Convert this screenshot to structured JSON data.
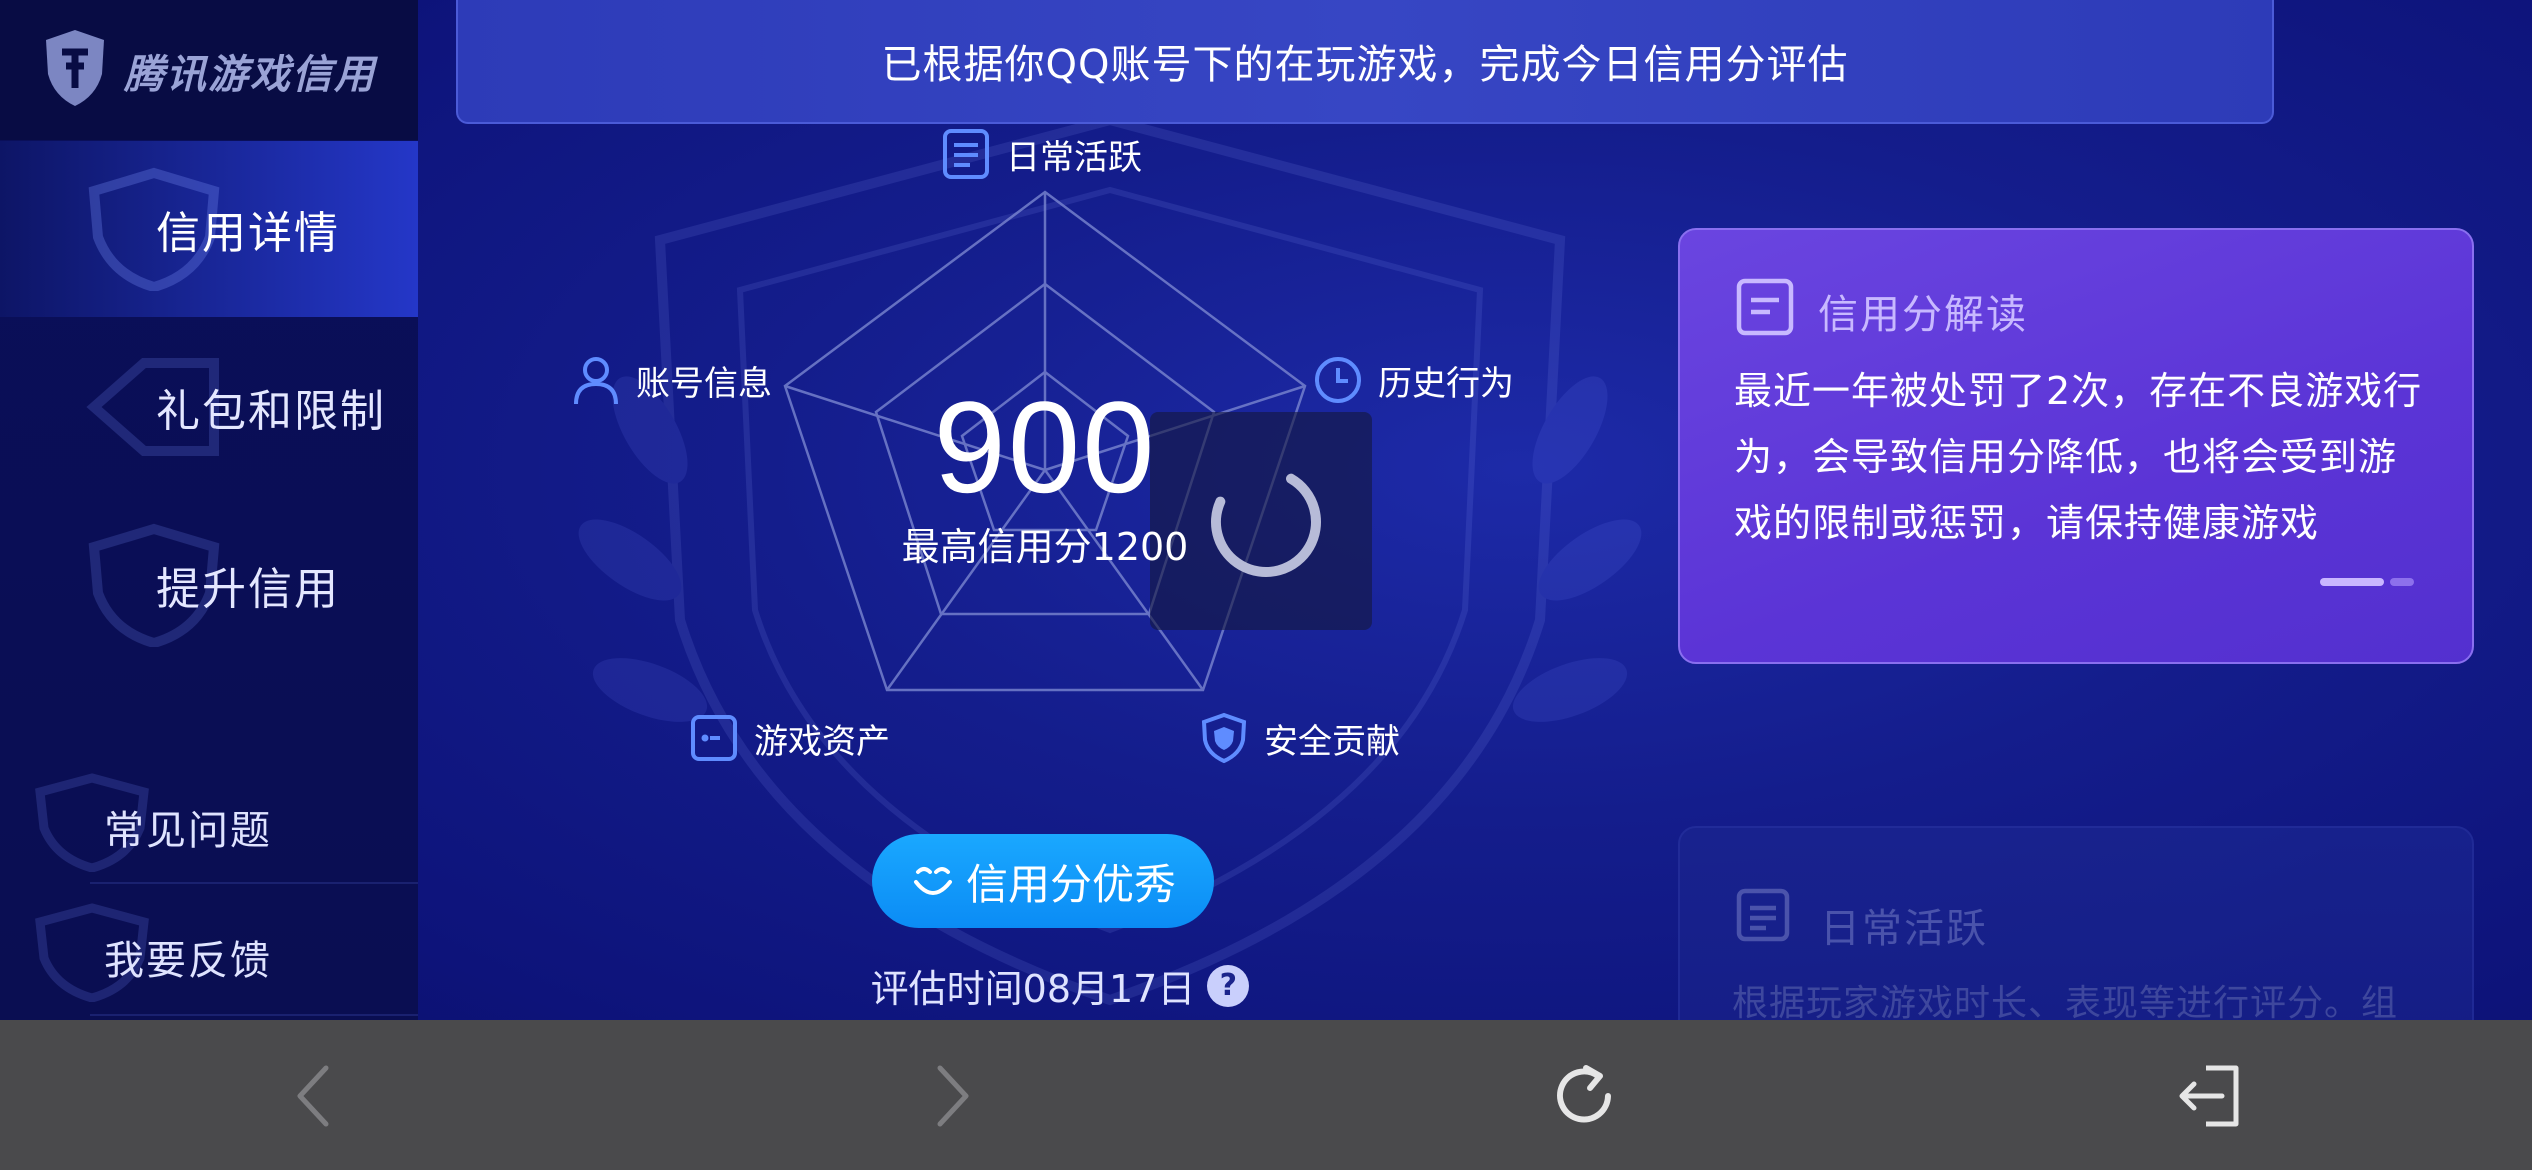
{
  "app": {
    "logo_text": "腾讯游戏信用"
  },
  "sidebar": {
    "items": [
      {
        "label": "信用详情",
        "active": true
      },
      {
        "label": "礼包和限制",
        "active": false
      },
      {
        "label": "提升信用",
        "active": false
      }
    ],
    "sub_items": [
      {
        "label": "常见问题"
      },
      {
        "label": "我要反馈"
      }
    ]
  },
  "banner": {
    "text": "已根据你QQ账号下的在玩游戏，完成今日信用分评估"
  },
  "radar": {
    "axes": [
      {
        "label": "日常活跃",
        "icon": "document-icon"
      },
      {
        "label": "历史行为",
        "icon": "clock-icon"
      },
      {
        "label": "安全贡献",
        "icon": "shield-icon"
      },
      {
        "label": "游戏资产",
        "icon": "wallet-icon"
      },
      {
        "label": "账号信息",
        "icon": "user-icon"
      }
    ],
    "score": "900",
    "max_score_text": "最高信用分1200"
  },
  "status_button": {
    "label": "信用分优秀",
    "icon": "smile-icon"
  },
  "eval_time": {
    "text": "评估时间08月17日",
    "help_icon_text": "?"
  },
  "card_interpret": {
    "title": "信用分解读",
    "body": "最近一年被处罚了2次，存在不良游戏行为，会导致信用分降低，也将会受到游戏的限制或惩罚，请保持健康游戏"
  },
  "card_daily": {
    "title": "日常活跃",
    "body": "根据玩家游戏时长、表现等进行评分。组"
  },
  "bottom_bar": {
    "icons": [
      "back-icon",
      "forward-icon",
      "refresh-icon",
      "exit-icon"
    ]
  },
  "colors": {
    "background": "#141d8c",
    "accent_button": "#0b8cf5",
    "card_purple": "#5b34d6",
    "bottom_bar": "#4a4a4c"
  }
}
